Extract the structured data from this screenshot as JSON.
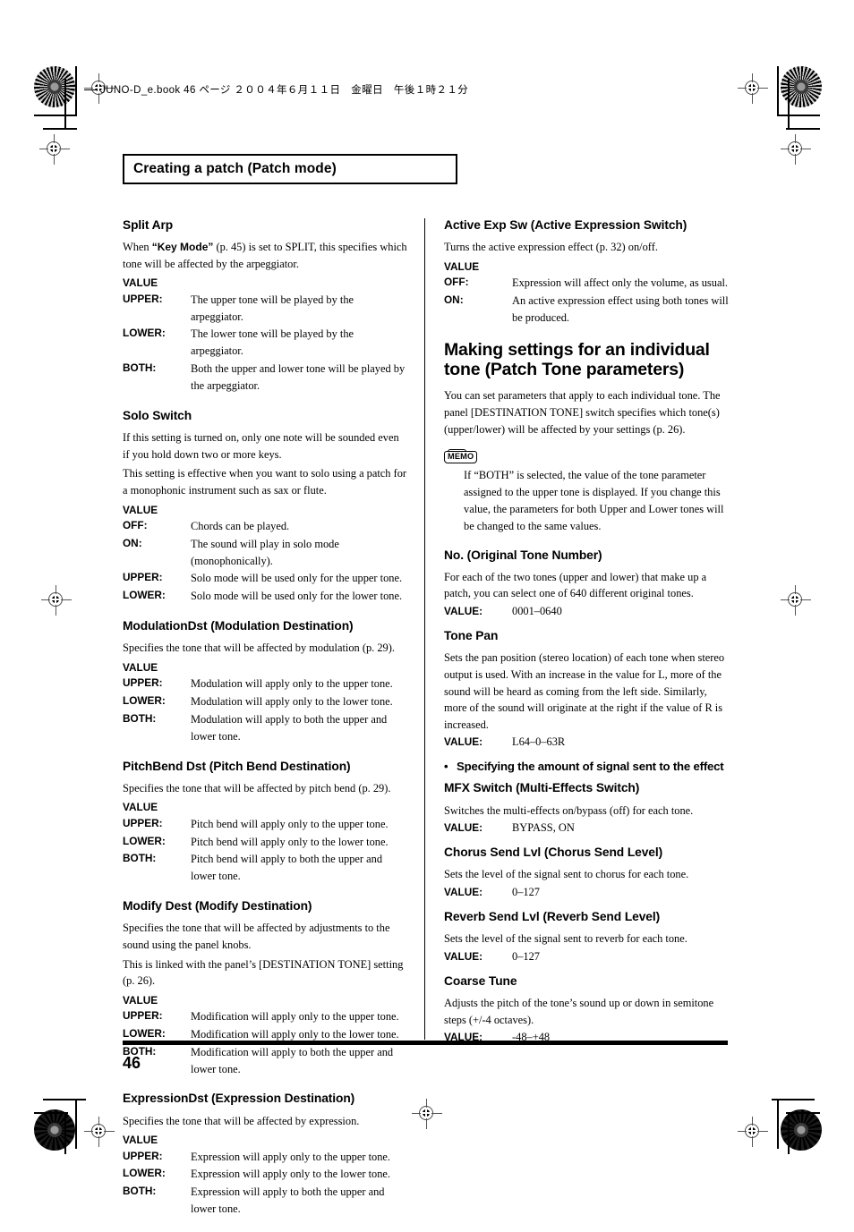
{
  "print_header": "JUNO-D_e.book 46 ページ ２００４年６月１１日　金曜日　午後１時２１分",
  "chapter_title": "Creating a patch (Patch mode)",
  "page_number": "46",
  "value_label": "VALUE",
  "left_column": [
    {
      "heading": "Split Arp",
      "paragraphs": [
        "When “Key Mode” (p. 45) is set to SPLIT, this specifies which tone will be affected by the arpeggiator."
      ],
      "value_label": "VALUE",
      "rows": [
        {
          "key": "UPPER:",
          "desc": "The upper tone will be played by the arpeggiator."
        },
        {
          "key": "LOWER:",
          "desc": "The lower tone will be played by the arpeggiator."
        },
        {
          "key": "BOTH:",
          "desc": "Both the upper and lower tone will be played by the arpeggiator."
        }
      ]
    },
    {
      "heading": "Solo Switch",
      "paragraphs": [
        "If this setting is turned on, only one note will be sounded even if you hold down two or more keys.",
        "This setting is effective when you want to solo using a patch for a monophonic instrument such as sax or flute."
      ],
      "value_label": "VALUE",
      "rows": [
        {
          "key": "OFF:",
          "desc": "Chords can be played."
        },
        {
          "key": "ON:",
          "desc": "The sound will play in solo mode (monophonically)."
        },
        {
          "key": "UPPER:",
          "desc": "Solo mode will be used only for the upper tone."
        },
        {
          "key": "LOWER:",
          "desc": "Solo mode will be used only for the lower tone."
        }
      ]
    },
    {
      "heading": "ModulationDst (Modulation Destination)",
      "paragraphs": [
        "Specifies the tone that will be affected by modulation (p. 29)."
      ],
      "value_label": "VALUE",
      "rows": [
        {
          "key": "UPPER:",
          "desc": "Modulation will apply only to the upper tone."
        },
        {
          "key": "LOWER:",
          "desc": "Modulation will apply only to the lower tone."
        },
        {
          "key": "BOTH:",
          "desc": "Modulation will apply to both the upper and lower tone."
        }
      ]
    },
    {
      "heading": "PitchBend Dst (Pitch Bend Destination)",
      "paragraphs": [
        "Specifies the tone that will be affected by pitch bend (p. 29)."
      ],
      "value_label": "VALUE",
      "rows": [
        {
          "key": "UPPER:",
          "desc": "Pitch bend will apply only to the upper tone."
        },
        {
          "key": "LOWER:",
          "desc": "Pitch bend will apply only to the lower tone."
        },
        {
          "key": "BOTH:",
          "desc": "Pitch bend will apply to both the upper and lower tone."
        }
      ]
    },
    {
      "heading": "Modify Dest (Modify Destination)",
      "paragraphs": [
        "Specifies the tone that will be affected by adjustments to the sound using the panel knobs.",
        "This is linked with the panel’s [DESTINATION TONE] setting (p. 26)."
      ],
      "value_label": "VALUE",
      "rows": [
        {
          "key": "UPPER:",
          "desc": "Modification will apply only to the upper tone."
        },
        {
          "key": "LOWER:",
          "desc": "Modification will apply only to the lower tone."
        },
        {
          "key": "BOTH:",
          "desc": "Modification will apply to both the upper and lower tone."
        }
      ]
    },
    {
      "heading": "ExpressionDst (Expression Destination)",
      "paragraphs": [
        "Specifies the tone that will be affected by expression."
      ],
      "value_label": "VALUE",
      "rows": [
        {
          "key": "UPPER:",
          "desc": "Expression will apply only to the upper tone."
        },
        {
          "key": "LOWER:",
          "desc": "Expression will apply only to the lower tone."
        },
        {
          "key": "BOTH:",
          "desc": "Expression will apply to both the upper and lower tone."
        }
      ]
    }
  ],
  "right_column": {
    "active_exp": {
      "heading": "Active Exp Sw (Active Expression Switch)",
      "paragraphs": [
        "Turns the active expression effect (p. 32) on/off."
      ],
      "value_label": "VALUE",
      "rows": [
        {
          "key": "OFF:",
          "desc": "Expression will affect only the volume, as usual."
        },
        {
          "key": "ON:",
          "desc": "An active expression effect using both tones will be produced."
        }
      ]
    },
    "big_section": {
      "heading": "Making settings for an individual tone (Patch Tone parameters)",
      "paragraphs": [
        "You can set parameters that apply to each individual tone. The panel [DESTINATION TONE] switch specifies which tone(s) (upper/lower) will be affected by your settings (p. 26)."
      ],
      "memo": {
        "badge": "MEMO",
        "text": "If “BOTH” is selected, the value of the tone parameter assigned to the upper tone is displayed. If you change this value, the parameters for both Upper and Lower tones will be changed to the same values."
      }
    },
    "sections": [
      {
        "heading": "No. (Original Tone Number)",
        "paragraphs": [
          "For each of the two tones (upper and lower) that make up a patch, you can select one of 640 different original tones."
        ],
        "value_label": "VALUE:",
        "value": "0001–0640"
      },
      {
        "heading": "Tone Pan",
        "paragraphs": [
          "Sets the pan position (stereo location) of each tone when stereo output is used. With an increase in the value for L, more of the sound will be heard as coming from the left side. Similarly, more of the sound will originate at the right if the value of R is increased."
        ],
        "value_label": "VALUE:",
        "value": "L64–0–63R"
      }
    ],
    "bullet_heading": {
      "bullet": "•",
      "text": "Specifying the amount of signal sent to the effect"
    },
    "effect_sections": [
      {
        "heading": "MFX Switch (Multi-Effects Switch)",
        "paragraphs": [
          "Switches the multi-effects on/bypass (off) for each tone."
        ],
        "value_label": "VALUE:",
        "value": "BYPASS, ON"
      },
      {
        "heading": "Chorus Send Lvl (Chorus Send Level)",
        "paragraphs": [
          "Sets the level of the signal sent to chorus for each tone."
        ],
        "value_label": "VALUE:",
        "value": "0–127"
      },
      {
        "heading": "Reverb Send Lvl (Reverb Send Level)",
        "paragraphs": [
          "Sets the level of the signal sent to reverb for each tone."
        ],
        "value_label": "VALUE:",
        "value": "0–127"
      },
      {
        "heading": "Coarse Tune",
        "paragraphs": [
          "Adjusts the pitch of the tone’s sound up or down in semitone steps (+/-4 octaves)."
        ],
        "value_label": "VALUE:",
        "value": "-48–+48"
      }
    ]
  }
}
